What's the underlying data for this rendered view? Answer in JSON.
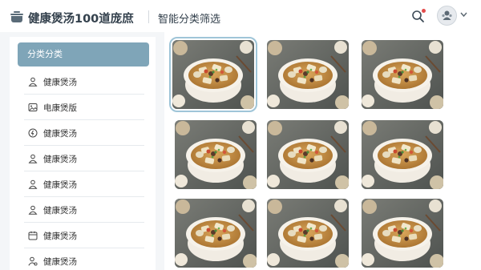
{
  "header": {
    "app_title": "健康煲汤100道庞庶",
    "page_title": "智能分类筛选",
    "icons": [
      "pot-icon",
      "search-icon",
      "avatar-icon",
      "chevron-down-icon"
    ],
    "notification_color": "#e34c4c"
  },
  "sidebar": {
    "active_label": "分类分类",
    "accent": "#7fa5b8",
    "items": [
      {
        "label": "健康煲汤",
        "icon": "user-icon"
      },
      {
        "label": "电康煲版",
        "icon": "image-icon"
      },
      {
        "label": "健康煲汤",
        "icon": "info-icon"
      },
      {
        "label": "健康煲汤",
        "icon": "user-icon"
      },
      {
        "label": "健康煲汤",
        "icon": "user-icon"
      },
      {
        "label": "健康煲汤",
        "icon": "user-icon"
      },
      {
        "label": "健康煲汤",
        "icon": "calendar-icon"
      },
      {
        "label": "健康煲汤",
        "icon": "user-settings-icon"
      }
    ]
  },
  "grid": {
    "selected_index": 0,
    "images": [
      {
        "name": "soup-image-1"
      },
      {
        "name": "soup-image-2"
      },
      {
        "name": "soup-image-3"
      },
      {
        "name": "soup-image-4"
      },
      {
        "name": "soup-image-5"
      },
      {
        "name": "soup-image-6"
      },
      {
        "name": "soup-image-7"
      },
      {
        "name": "soup-image-8"
      },
      {
        "name": "soup-image-9"
      }
    ]
  }
}
